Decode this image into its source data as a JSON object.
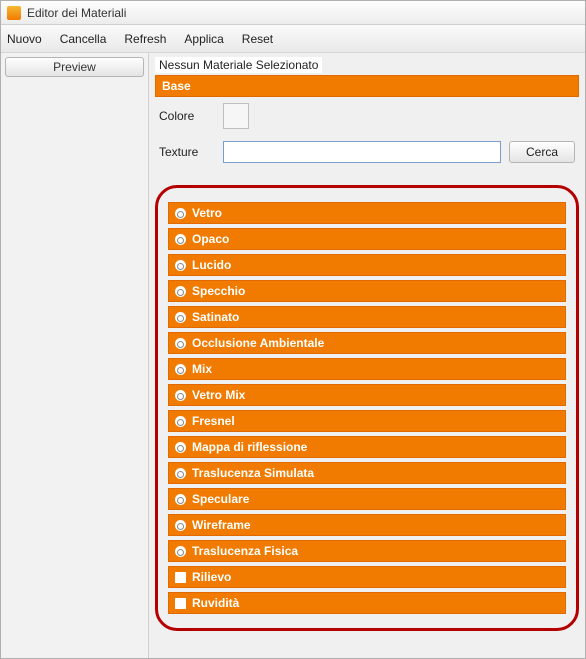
{
  "window": {
    "title": "Editor dei Materiali"
  },
  "menu": {
    "nuovo": "Nuovo",
    "cancella": "Cancella",
    "refresh": "Refresh",
    "applica": "Applica",
    "reset": "Reset"
  },
  "sidebar": {
    "preview_label": "Preview"
  },
  "main": {
    "status": "Nessun Materiale Selezionato",
    "base_header": "Base",
    "colore_label": "Colore",
    "texture_label": "Texture",
    "texture_value": "",
    "cerca_label": "Cerca"
  },
  "properties": [
    {
      "type": "radio",
      "label": "Vetro"
    },
    {
      "type": "radio",
      "label": "Opaco"
    },
    {
      "type": "radio",
      "label": "Lucido"
    },
    {
      "type": "radio",
      "label": "Specchio"
    },
    {
      "type": "radio",
      "label": "Satinato"
    },
    {
      "type": "radio",
      "label": "Occlusione Ambientale"
    },
    {
      "type": "radio",
      "label": "Mix"
    },
    {
      "type": "radio",
      "label": "Vetro Mix"
    },
    {
      "type": "radio",
      "label": "Fresnel"
    },
    {
      "type": "radio",
      "label": "Mappa di riflessione"
    },
    {
      "type": "radio",
      "label": "Traslucenza Simulata"
    },
    {
      "type": "radio",
      "label": "Speculare"
    },
    {
      "type": "radio",
      "label": "Wireframe"
    },
    {
      "type": "radio",
      "label": "Traslucenza Fisica"
    },
    {
      "type": "check",
      "label": "Rilievo"
    },
    {
      "type": "check",
      "label": "Ruvidità"
    }
  ]
}
